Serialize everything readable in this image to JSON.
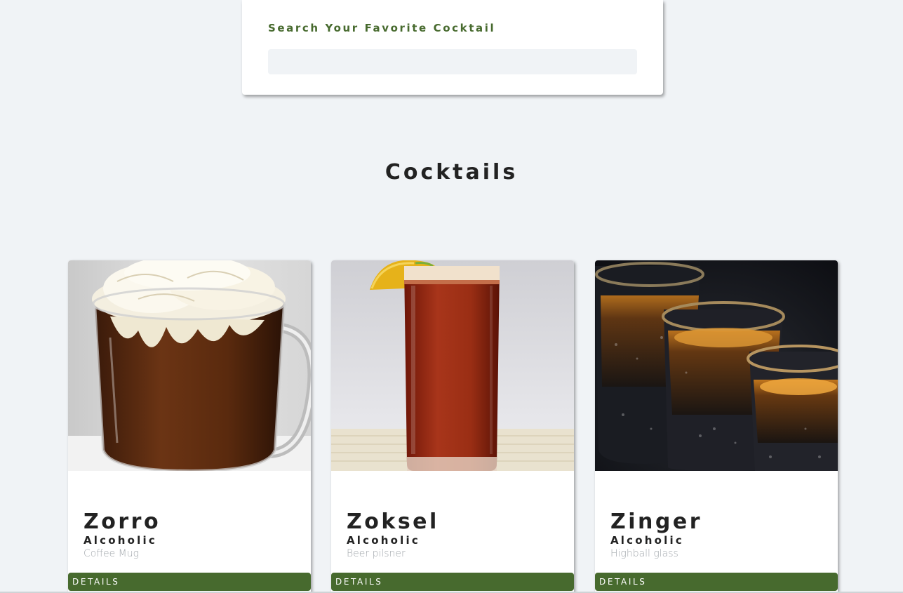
{
  "search": {
    "label": "Search Your Favorite Cocktail",
    "value": "",
    "placeholder": ""
  },
  "section": {
    "title": "Cocktails"
  },
  "colors": {
    "accent": "#476a2e",
    "background": "#f0f3f6",
    "heading": "#222222",
    "muted": "#a3a8ad"
  },
  "cocktails": [
    {
      "name": "Zorro",
      "type": "Alcoholic",
      "glass": "Coffee Mug",
      "button": "DETAILS",
      "image": "coffee-mug-whipped-cream-photo"
    },
    {
      "name": "Zoksel",
      "type": "Alcoholic",
      "glass": "Beer pilsner",
      "button": "DETAILS",
      "image": "red-beer-glass-lemon-photo"
    },
    {
      "name": "Zinger",
      "type": "Alcoholic",
      "glass": "Highball glass",
      "button": "DETAILS",
      "image": "shot-glasses-dark-drink-photo"
    }
  ]
}
